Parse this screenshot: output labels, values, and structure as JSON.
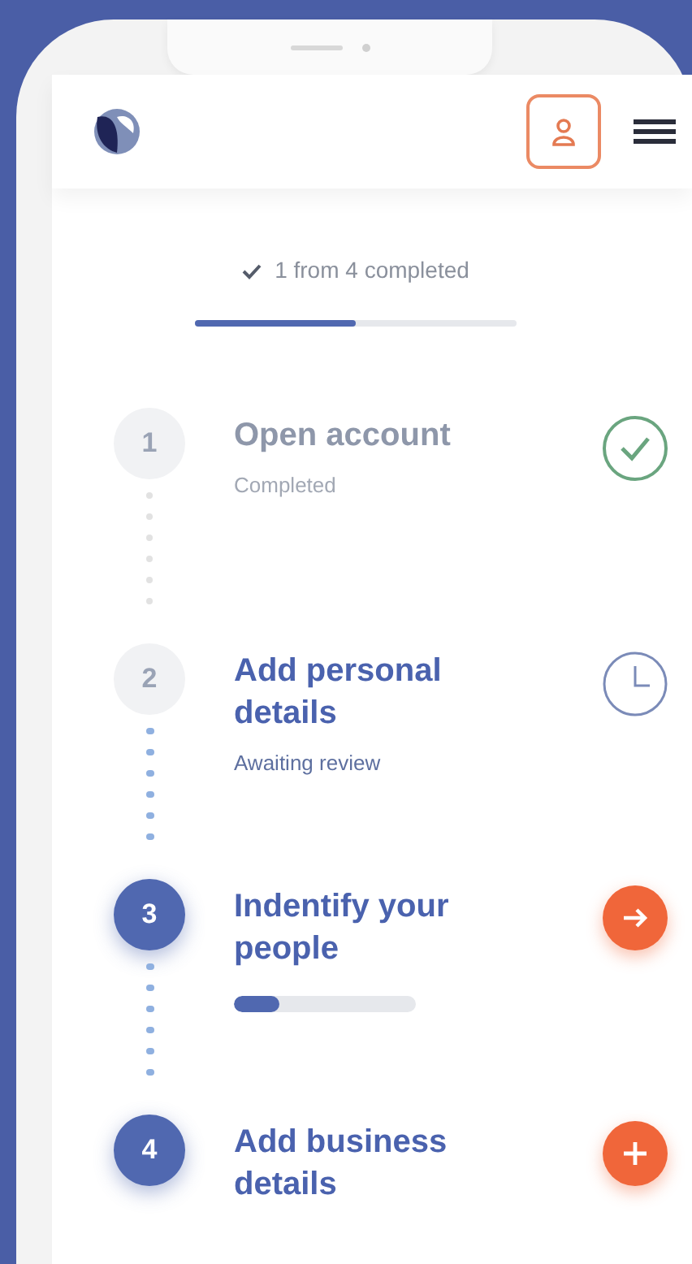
{
  "progress": {
    "summary": "1 from 4 completed",
    "level": 0.5
  },
  "steps": [
    {
      "number": "1",
      "title": "Open account",
      "subtitle": "Completed",
      "kind": "completed"
    },
    {
      "number": "2",
      "title": "Add personal details",
      "subtitle": "Awaiting review",
      "kind": "pending"
    },
    {
      "number": "3",
      "title": "Indentify your people",
      "level": 0.25,
      "kind": "active"
    },
    {
      "number": "4",
      "title": "Add business details",
      "kind": "todo"
    }
  ]
}
